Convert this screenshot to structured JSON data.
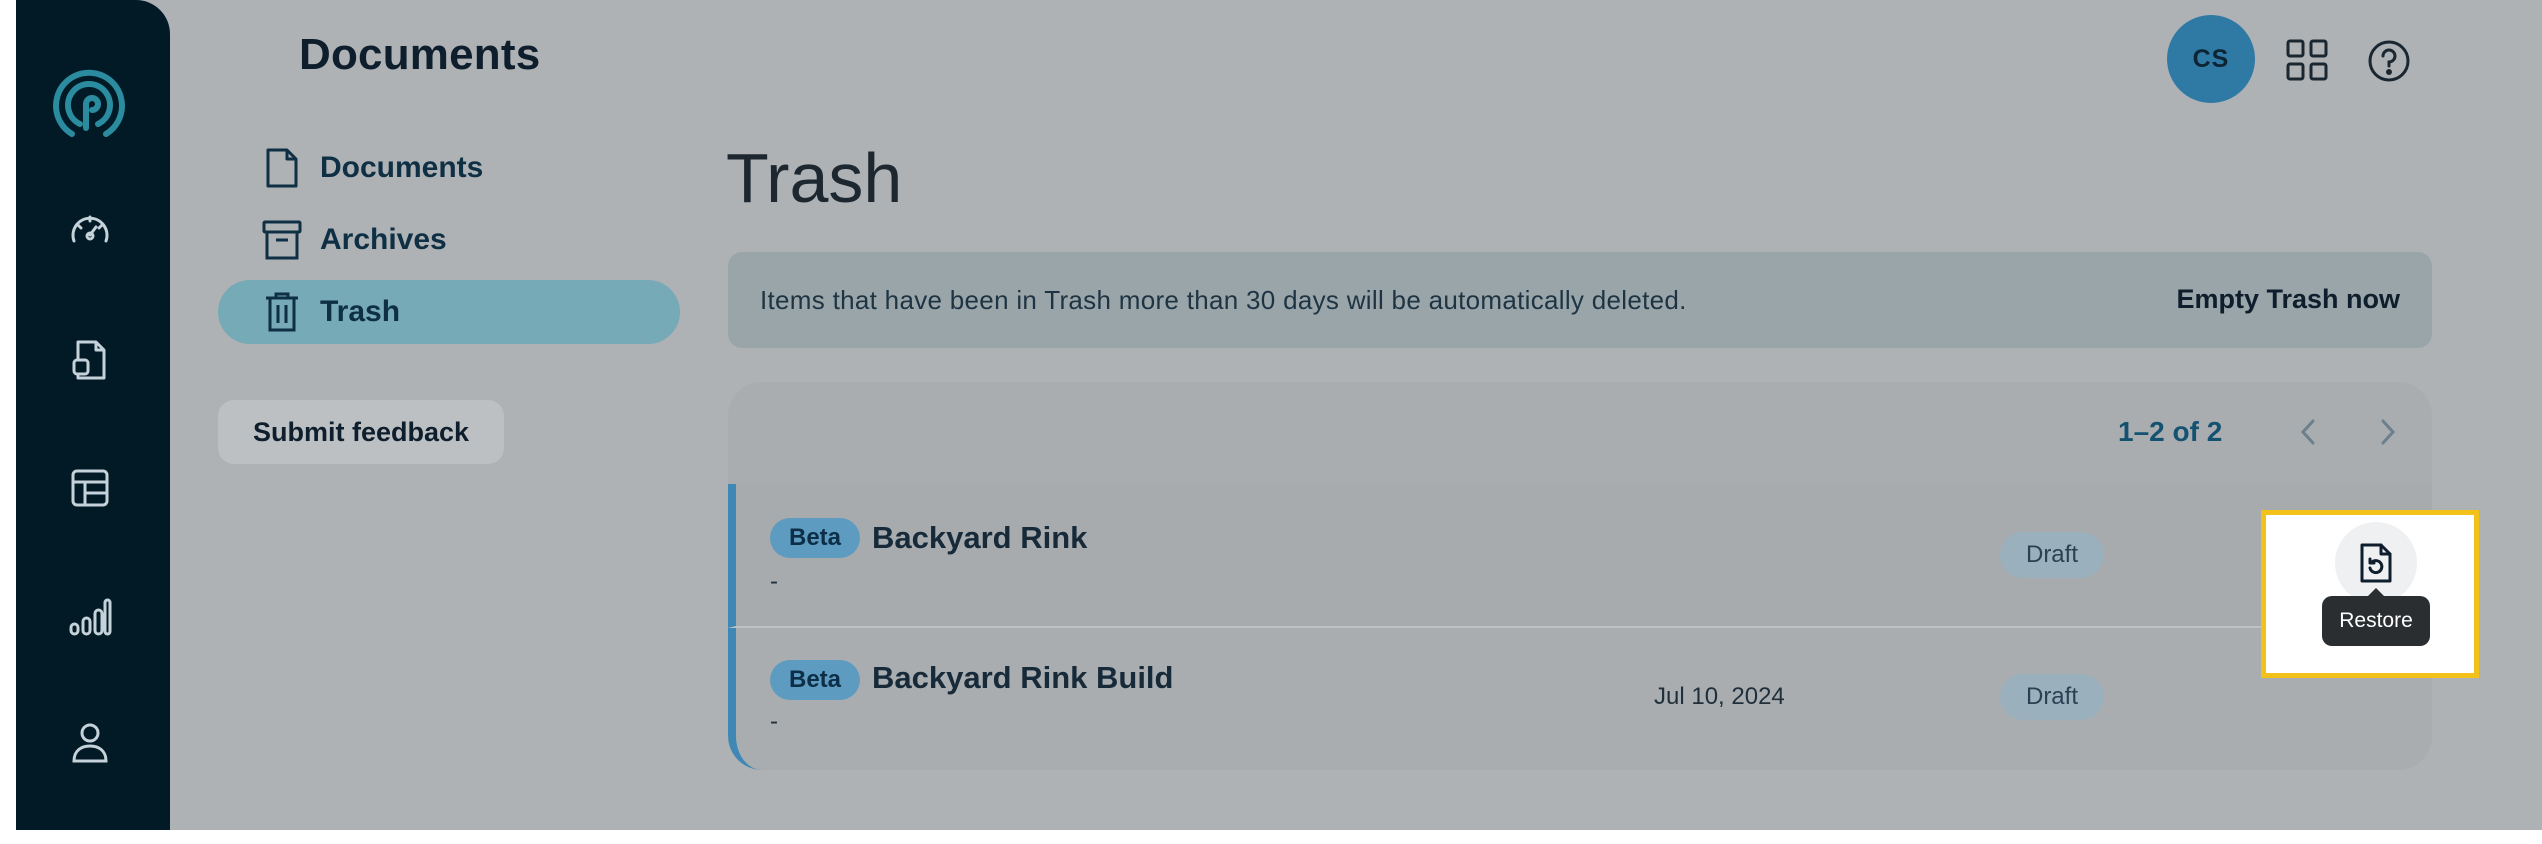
{
  "header": {
    "app_title": "Documents",
    "avatar_initials": "CS"
  },
  "rail": {
    "items": [
      {
        "icon": "dashboard-icon"
      },
      {
        "icon": "documents-icon"
      },
      {
        "icon": "templates-icon"
      },
      {
        "icon": "analytics-icon"
      },
      {
        "icon": "user-icon"
      }
    ]
  },
  "sidebar": {
    "items": [
      {
        "label": "Documents",
        "icon": "file-icon",
        "active": false
      },
      {
        "label": "Archives",
        "icon": "archive-icon",
        "active": false
      },
      {
        "label": "Trash",
        "icon": "trash-icon",
        "active": true
      }
    ],
    "feedback_label": "Submit feedback"
  },
  "main": {
    "title": "Trash",
    "notice": {
      "text": "Items that have been in Trash more than 30 days will be automatically deleted.",
      "action": "Empty Trash now"
    },
    "pager": {
      "text": "1–2 of 2"
    },
    "rows": [
      {
        "badge": "Beta",
        "name": "Backyard Rink",
        "subtitle": "-",
        "date": "",
        "status": "Draft"
      },
      {
        "badge": "Beta",
        "name": "Backyard Rink Build",
        "subtitle": "-",
        "date": "Jul 10, 2024",
        "status": "Draft"
      }
    ],
    "restore_tooltip": "Restore"
  },
  "colors": {
    "rail": "#021a26",
    "accent": "#2f7aa5",
    "active_nav": "#75aab6",
    "highlight": "#f2c21b"
  }
}
